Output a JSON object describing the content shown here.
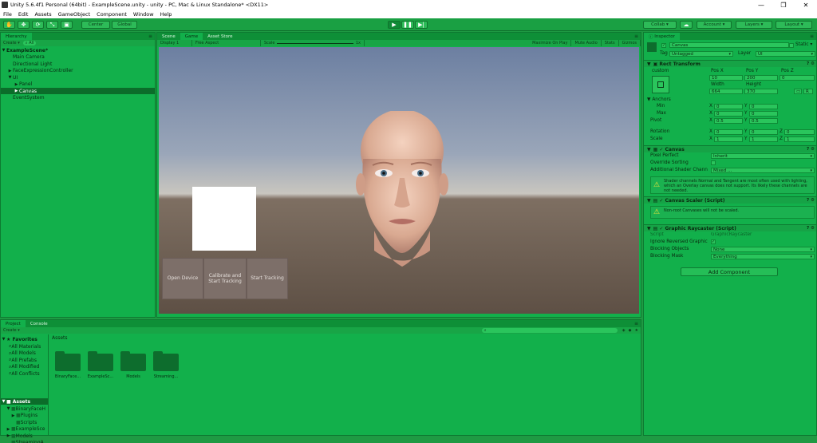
{
  "window": {
    "title": "Unity 5.6.4f1 Personal (64bit) - ExampleScene.unity - unity - PC, Mac & Linux Standalone* <DX11>",
    "minimize": "—",
    "maximize": "❐",
    "close": "✕"
  },
  "menu": [
    "File",
    "Edit",
    "Assets",
    "GameObject",
    "Component",
    "Window",
    "Help"
  ],
  "toolbar": {
    "pivot": "Center",
    "space": "Global",
    "play": "▶",
    "pause": "❚❚",
    "step": "▶|",
    "collab": "Collab ▾",
    "cloud": "☁",
    "account": "Account ▾",
    "layers": "Layers ▾",
    "layout": "Layout ▾"
  },
  "hierarchy": {
    "tab": "Hierarchy",
    "create": "Create ▾",
    "search": "All",
    "items": [
      {
        "label": "ExampleScene*",
        "arrow": "▼",
        "indent": 0,
        "selected": false,
        "bold": true
      },
      {
        "label": "Main Camera",
        "arrow": "",
        "indent": 1,
        "selected": false
      },
      {
        "label": "Directional Light",
        "arrow": "",
        "indent": 1,
        "selected": false
      },
      {
        "label": "FaceExpressionController",
        "arrow": "▶",
        "indent": 1,
        "selected": false
      },
      {
        "label": "UI",
        "arrow": "▼",
        "indent": 1,
        "selected": false
      },
      {
        "label": "Panel",
        "arrow": "▶",
        "indent": 2,
        "selected": false
      },
      {
        "label": "Canvas",
        "arrow": "▶",
        "indent": 2,
        "selected": true
      },
      {
        "label": "EventSystem",
        "arrow": "",
        "indent": 1,
        "selected": false
      }
    ]
  },
  "center_tabs": [
    "Scene",
    "Game",
    "Asset Store"
  ],
  "game_toolbar": {
    "display": "Display 1",
    "aspect": "Free Aspect",
    "scale_label": "Scale",
    "scale_value": "1x",
    "maximize": "Maximize On Play",
    "mute": "Mute Audio",
    "stats": "Stats",
    "gizmos": "Gizmos"
  },
  "game_buttons": [
    "Open Device",
    "Calibrate and Start Tracking",
    "Start Tracking"
  ],
  "project": {
    "tabs": [
      "Project",
      "Console"
    ],
    "create": "Create ▾",
    "breadcrumb": "Assets",
    "favorites_label": "Favorites",
    "favorites": [
      "All Materials",
      "All Models",
      "All Prefabs",
      "All Modified",
      "All Conflicts"
    ],
    "assets_label": "Assets",
    "tree": [
      {
        "label": "BinaryFaceH",
        "arrow": "▼",
        "indent": 1
      },
      {
        "label": "Plugins",
        "arrow": "▶",
        "indent": 2
      },
      {
        "label": "Scripts",
        "arrow": "",
        "indent": 2
      },
      {
        "label": "ExampleSce",
        "arrow": "▶",
        "indent": 1
      },
      {
        "label": "Models",
        "arrow": "▶",
        "indent": 1
      },
      {
        "label": "StreamingA",
        "arrow": "",
        "indent": 1
      }
    ],
    "asset_items": [
      "BinaryFace...",
      "ExampleSc...",
      "Models",
      "Streaming..."
    ]
  },
  "inspector": {
    "tab": "Inspector",
    "object_name": "Canvas",
    "static": "Static ▾",
    "tag_label": "Tag",
    "tag": "Untagged",
    "layer_label": "Layer",
    "layer": "UI",
    "rect_transform": {
      "title": "Rect Transform",
      "anchor_preset": "custom",
      "posx_label": "Pos X",
      "posy_label": "Pos Y",
      "posz_label": "Pos Z",
      "posx": "10",
      "posy": "200",
      "posz": "0",
      "width_label": "Width",
      "height_label": "Height",
      "width": "664",
      "height": "370",
      "r_button": "R",
      "anchors": "Anchors",
      "min": "Min",
      "max": "Max",
      "pivot": "Pivot",
      "min_x": "0",
      "min_y": "0",
      "max_x": "0",
      "max_y": "0",
      "pivot_x": "0.5",
      "pivot_y": "0.5",
      "rotation": "Rotation",
      "rot_x": "0",
      "rot_y": "0",
      "rot_z": "0",
      "scale": "Scale",
      "scale_x": "1",
      "scale_y": "1",
      "scale_z": "1",
      "x": "X",
      "y": "Y",
      "z": "Z"
    },
    "canvas": {
      "title": "Canvas",
      "pixel_perfect": "Pixel Perfect",
      "pixel_perfect_value": "Inherit",
      "override_sorting": "Override Sorting",
      "shader_channels": "Additional Shader Chann",
      "shader_channels_value": "Mixed ...",
      "note": "Shader channels Normal and Tangent are most often used with lighting, which an Overlay canvas does not support. Its likely these channels are not needed."
    },
    "canvas_scaler": {
      "title": "Canvas Scaler (Script)",
      "note": "Non-root Canvases will not be scaled."
    },
    "raycaster": {
      "title": "Graphic Raycaster (Script)",
      "script_label": "Script",
      "script_value": "GraphicRaycaster",
      "ignore_reversed": "Ignore Reversed Graphic",
      "ignore_reversed_checked": "✓",
      "blocking_objects": "Blocking Objects",
      "blocking_objects_value": "None",
      "blocking_mask": "Blocking Mask",
      "blocking_mask_value": "Everything"
    },
    "add_component": "Add Component"
  },
  "colors": {
    "unity_tint": "#1aa043",
    "selection": "#0b6d2a",
    "panel": "#12b04b"
  }
}
